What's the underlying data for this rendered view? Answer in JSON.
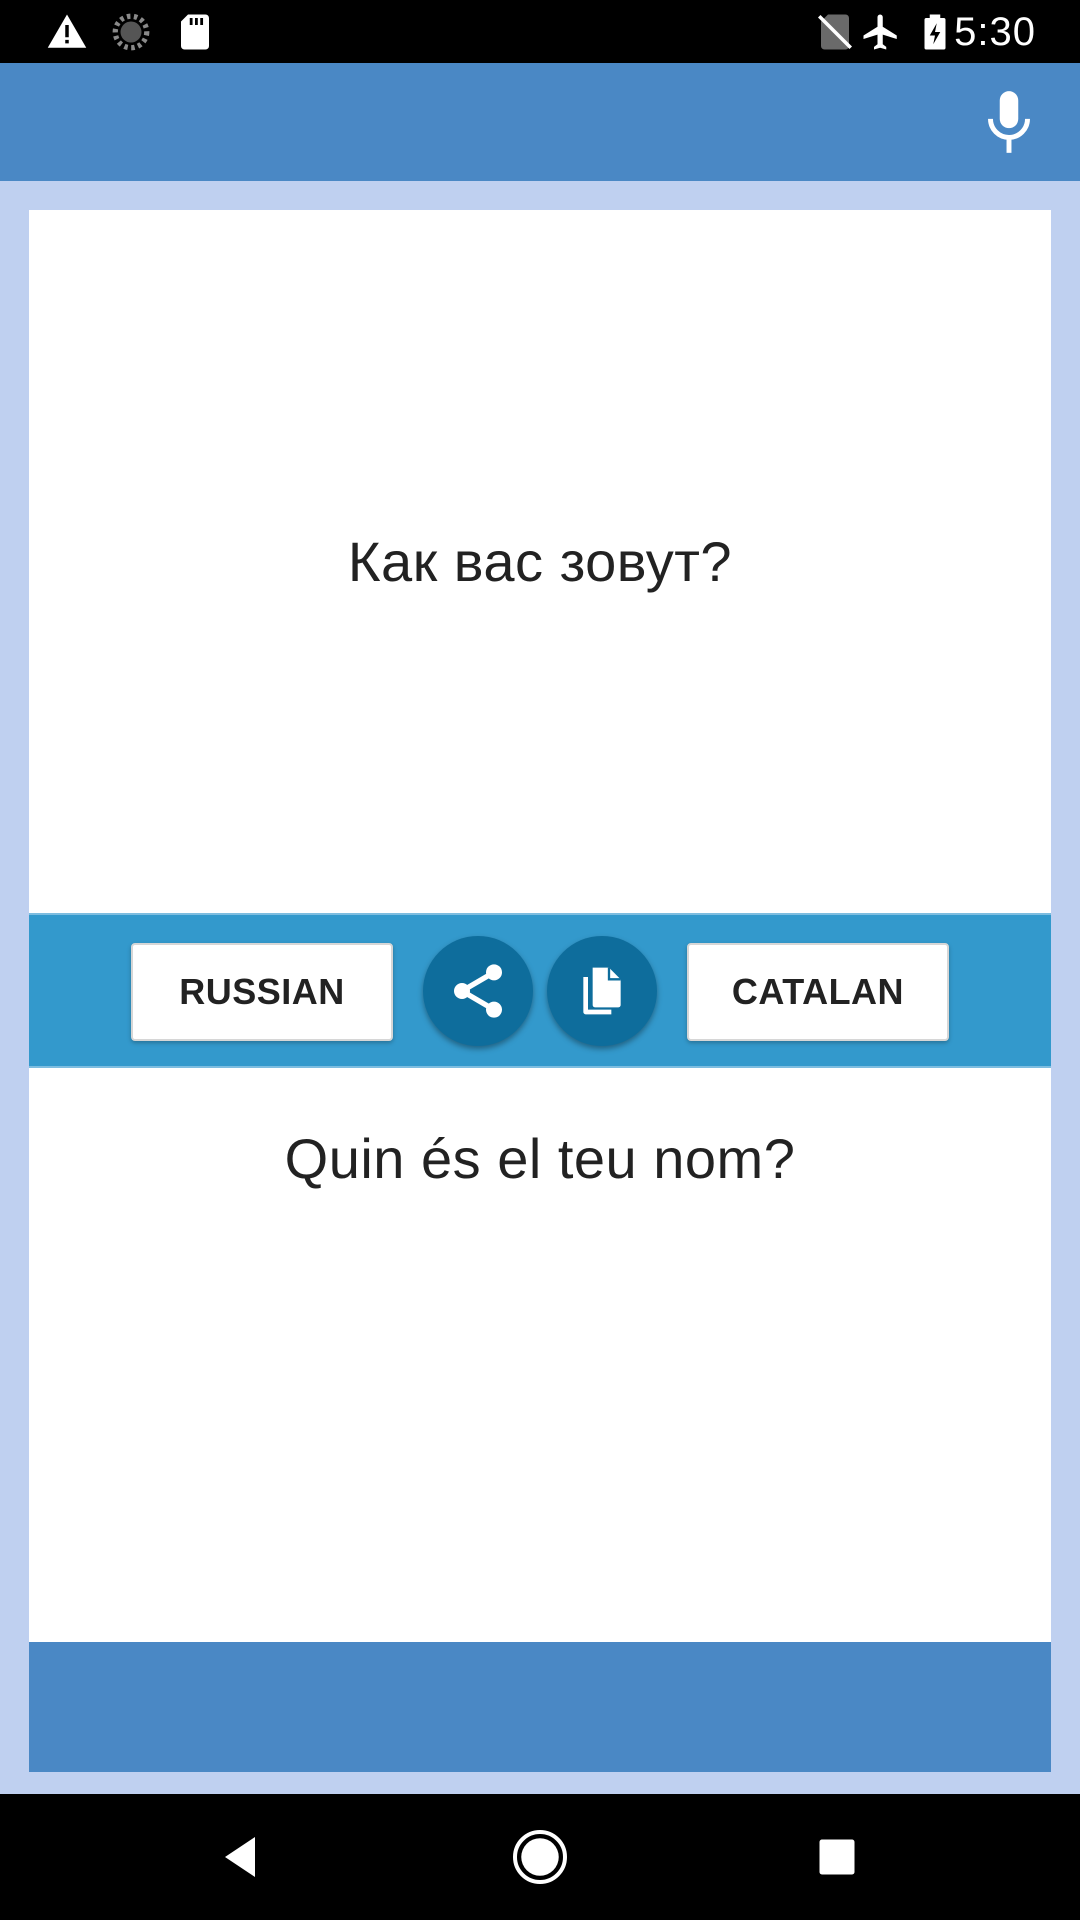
{
  "status_bar": {
    "time": "5:30",
    "icons": [
      "warning-icon",
      "sync-icon",
      "sd-card-icon",
      "no-sim-icon",
      "airplane-icon",
      "battery-charging-icon"
    ]
  },
  "app_bar": {
    "mic_icon": "microphone-icon"
  },
  "translation": {
    "source_text": "Как вас зовут?",
    "target_text": "Quin és el teu nom?",
    "source_language": "RUSSIAN",
    "target_language": "CATALAN"
  },
  "controls": {
    "share_icon": "share-icon",
    "copy_icon": "copy-icon"
  },
  "nav_bar": {
    "icons": [
      "back-icon",
      "home-icon",
      "recents-icon"
    ]
  },
  "colors": {
    "app_bar": "#4a88c5",
    "background": "#bfd0f0",
    "control_bar": "#3399cc",
    "round_button": "#0e6d9c"
  }
}
